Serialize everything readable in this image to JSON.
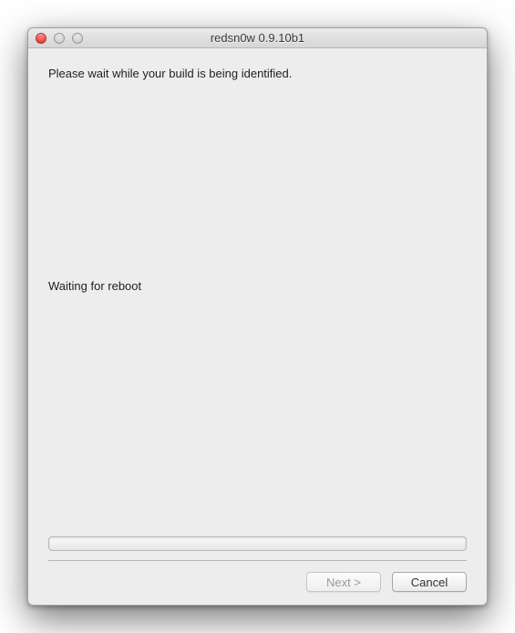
{
  "window": {
    "title": "redsn0w 0.9.10b1"
  },
  "content": {
    "heading": "Please wait while your build is being identified.",
    "status": "Waiting for reboot"
  },
  "buttons": {
    "next": "Next >",
    "cancel": "Cancel"
  }
}
